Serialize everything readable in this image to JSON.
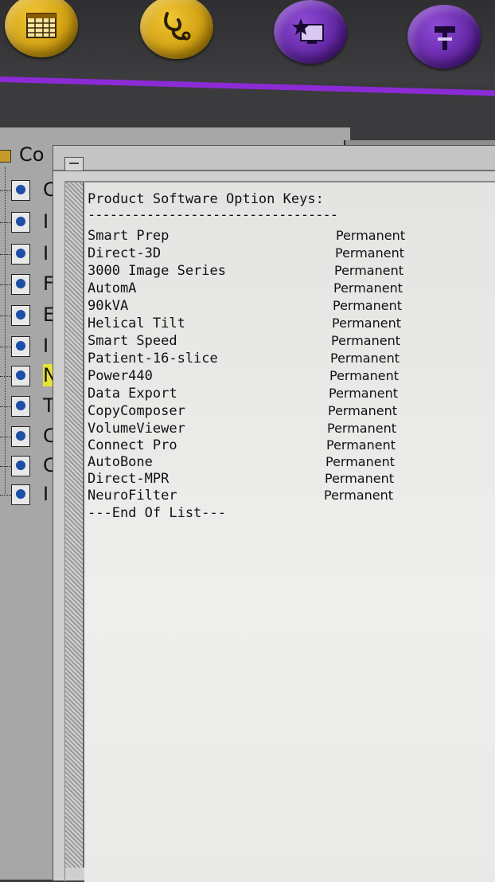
{
  "toolbar": {
    "buttons": [
      {
        "icon": "spreadsheet-icon",
        "color": "#e0b21e"
      },
      {
        "icon": "stethoscope-icon",
        "color": "#e0b21e"
      },
      {
        "icon": "star-monitor-icon",
        "color": "#6a2bb5"
      },
      {
        "icon": "tools-icon",
        "color": "#6a2bb5"
      }
    ],
    "accent_color": "#8c2bd6"
  },
  "background_panel": {
    "header_partial": "Co",
    "tree_letters": [
      "C",
      "I",
      "I",
      "F",
      "E",
      "I",
      "N",
      "T",
      "C",
      "C",
      "I"
    ],
    "selected_index": 6
  },
  "dialog": {
    "heading": "Product Software Option Keys:",
    "divider": "----------------------------------",
    "options": [
      {
        "name": "Smart Prep",
        "status": "Permanent"
      },
      {
        "name": "Direct-3D",
        "status": "Permanent"
      },
      {
        "name": "3000 Image Series",
        "status": "Permanent"
      },
      {
        "name": "AutomA",
        "status": "Permanent"
      },
      {
        "name": "90kVA",
        "status": "Permanent"
      },
      {
        "name": "Helical Tilt",
        "status": "Permanent"
      },
      {
        "name": "Smart Speed",
        "status": "Permanent"
      },
      {
        "name": "Patient-16-slice",
        "status": "Permanent"
      },
      {
        "name": "Power440",
        "status": "Permanent"
      },
      {
        "name": "Data Export",
        "status": "Permanent"
      },
      {
        "name": "CopyComposer",
        "status": "Permanent"
      },
      {
        "name": "VolumeViewer",
        "status": "Permanent"
      },
      {
        "name": "Connect Pro",
        "status": "Permanent"
      },
      {
        "name": "AutoBone",
        "status": "Permanent"
      },
      {
        "name": "Direct-MPR",
        "status": "Permanent"
      },
      {
        "name": "NeuroFilter",
        "status": "Permanent"
      }
    ],
    "end_text": "---End Of List---"
  }
}
